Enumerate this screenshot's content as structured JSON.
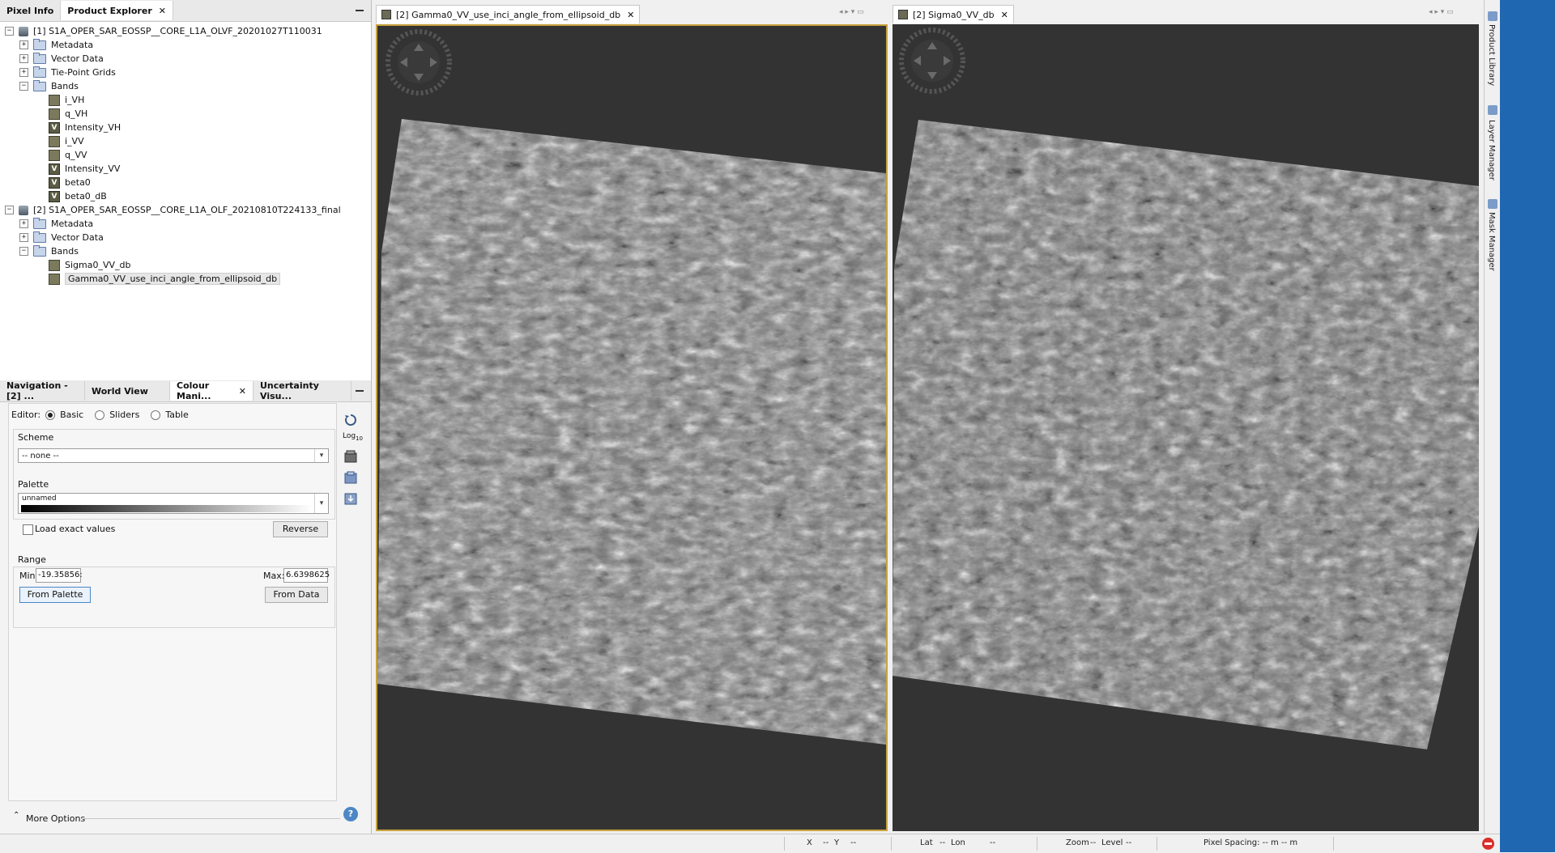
{
  "left_top": {
    "tabs": [
      {
        "label": "Pixel Info"
      },
      {
        "label": "Product Explorer"
      }
    ],
    "tree": [
      {
        "label": "[1] S1A_OPER_SAR_EOSSP__CORE_L1A_OLVF_20201027T110031"
      },
      {
        "label": "Metadata"
      },
      {
        "label": "Vector Data"
      },
      {
        "label": "Tie-Point Grids"
      },
      {
        "label": "Bands"
      },
      {
        "label": "i_VH"
      },
      {
        "label": "q_VH"
      },
      {
        "label": "Intensity_VH"
      },
      {
        "label": "i_VV"
      },
      {
        "label": "q_VV"
      },
      {
        "label": "Intensity_VV"
      },
      {
        "label": "beta0"
      },
      {
        "label": "beta0_dB"
      },
      {
        "label": "[2] S1A_OPER_SAR_EOSSP__CORE_L1A_OLF_20210810T224133_final"
      },
      {
        "label": "Metadata"
      },
      {
        "label": "Vector Data"
      },
      {
        "label": "Bands"
      },
      {
        "label": "Sigma0_VV_db"
      },
      {
        "label": "Gamma0_VV_use_inci_angle_from_ellipsoid_db"
      }
    ]
  },
  "left_bottom": {
    "tabs": [
      {
        "label": "Navigation - [2] ..."
      },
      {
        "label": "World View"
      },
      {
        "label": "Colour Mani..."
      },
      {
        "label": "Uncertainty Visu..."
      }
    ],
    "editor_label": "Editor:",
    "editor_options": [
      {
        "label": "Basic"
      },
      {
        "label": "Sliders"
      },
      {
        "label": "Table"
      }
    ],
    "scheme_label": "Scheme",
    "scheme_value": "-- none --",
    "palette_label": "Palette",
    "palette_value": "unnamed",
    "load_exact_label": "Load exact values",
    "reverse_label": "Reverse",
    "range_label": "Range",
    "min_label": "Min:",
    "min_value": "-19.35856:",
    "max_label": "Max:",
    "max_value": "6.6398625",
    "from_palette_label": "From Palette",
    "from_data_label": "From Data",
    "more_options_label": "More Options",
    "log_label": "Log",
    "log_sub": "10"
  },
  "views": [
    {
      "tab_label": "[2] Gamma0_VV_use_inci_angle_from_ellipsoid_db"
    },
    {
      "tab_label": "[2] Sigma0_VV_db"
    }
  ],
  "right_rail": {
    "items": [
      {
        "label": "Product Library"
      },
      {
        "label": "Layer Manager"
      },
      {
        "label": "Mask Manager"
      }
    ]
  },
  "status": {
    "x": "X",
    "x_val": "--",
    "y": "Y",
    "y_val": "--",
    "lat": "Lat",
    "lat_val": "--",
    "lon": "Lon",
    "lon_val": "--",
    "zoom": "Zoom",
    "zoom_val": "--",
    "level": "Level",
    "level_val": "--",
    "pixel_spacing": "Pixel Spacing: -- m -- m"
  },
  "colors": {
    "accent": "#1f67b1",
    "selected_border": "#c8a23c",
    "view_bg": "#333333"
  }
}
